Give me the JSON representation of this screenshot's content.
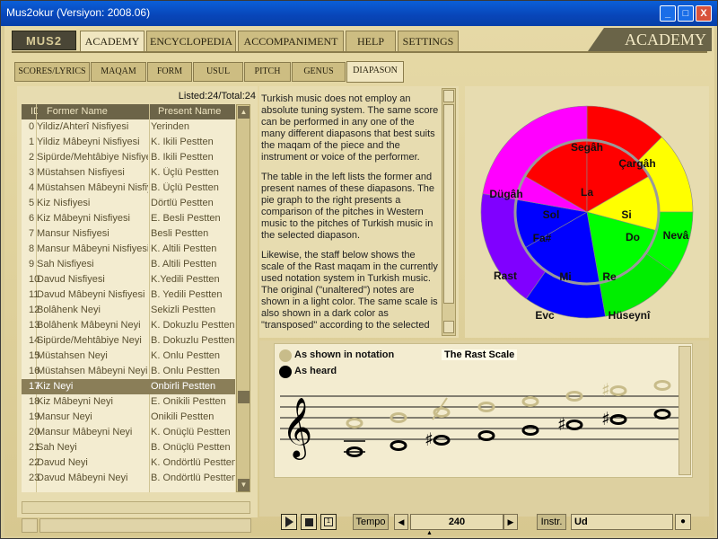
{
  "window": {
    "title": "Mus2okur  (Versiyon: 2008.06)",
    "controls": [
      "_",
      "□",
      "X"
    ]
  },
  "logo": "MUS2",
  "header": {
    "title": "ACADEMY"
  },
  "main_tabs": [
    {
      "label": "ACADEMY",
      "active": true
    },
    {
      "label": "ENCYCLOPEDIA",
      "active": false
    },
    {
      "label": "ACCOMPANIMENT",
      "active": false
    },
    {
      "label": "HELP",
      "active": false
    },
    {
      "label": "SETTINGS",
      "active": false
    }
  ],
  "sub_tabs": [
    {
      "label": "SCORES/LYRICS"
    },
    {
      "label": "MAQAM"
    },
    {
      "label": "FORM"
    },
    {
      "label": "USUL"
    },
    {
      "label": "PITCH"
    },
    {
      "label": "GENUS"
    },
    {
      "label": "DIAPASON",
      "active": true
    }
  ],
  "list": {
    "listed": "Listed:24/Total:24",
    "columns": [
      "ID",
      "Former Name",
      "Present Name"
    ],
    "selected_index": 17,
    "rows": [
      [
        "0",
        "Yildiz/Ahterî Nisfiyesi",
        "Yerinden"
      ],
      [
        "1",
        "Yildiz Mâbeyni Nisfiyesi",
        "K. Ikili Pestten"
      ],
      [
        "2",
        "Sipürde/Mehtâbiye Nisfiyesi",
        "B. Ikili Pestten"
      ],
      [
        "3",
        "Müstahsen Nisfiyesi",
        "K. Üçlü Pestten"
      ],
      [
        "4",
        "Müstahsen Mâbeyni Nisfiyesi",
        "B. Üçlü Pestten"
      ],
      [
        "5",
        "Kiz Nisfiyesi",
        "Dörtlü Pestten"
      ],
      [
        "6",
        "Kiz Mâbeyni Nisfiyesi",
        "E. Besli Pestten"
      ],
      [
        "7",
        "Mansur Nisfiyesi",
        "Besli Pestten"
      ],
      [
        "8",
        "Mansur Mâbeyni Nisfiyesi",
        "K. Altili Pestten"
      ],
      [
        "9",
        "Sah Nisfiyesi",
        "B. Altili Pestten"
      ],
      [
        "10",
        "Davud Nisfiyesi",
        "K.Yedili Pestten"
      ],
      [
        "11",
        "Davud Mâbeyni Nisfiyesi",
        "B. Yedili Pestten"
      ],
      [
        "12",
        "Bolâhenk Neyi",
        "Sekizli Pestten"
      ],
      [
        "13",
        "Bolâhenk Mâbeyni Neyi",
        "K. Dokuzlu Pestten"
      ],
      [
        "14",
        "Sipürde/Mehtâbiye Neyi",
        "B. Dokuzlu Pestten"
      ],
      [
        "15",
        "Müstahsen Neyi",
        "K. Onlu Pestten"
      ],
      [
        "16",
        "Müstahsen Mâbeyni Neyi",
        "B. Onlu Pestten"
      ],
      [
        "17",
        "Kiz Neyi",
        "Onbirli Pestten"
      ],
      [
        "18",
        "Kiz Mâbeyni Neyi",
        "E. Onikili Pestten"
      ],
      [
        "19",
        "Mansur Neyi",
        "Onikili Pestten"
      ],
      [
        "20",
        "Mansur Mâbeyni Neyi",
        "K. Onüçlü Pestten"
      ],
      [
        "21",
        "Sah Neyi",
        "B. Onüçlü Pestten"
      ],
      [
        "22",
        "Davud Neyi",
        "K. Ondörtlü Pestten"
      ],
      [
        "23",
        "Davud Mâbeyni Neyi",
        "B. Ondörtlü Pestten"
      ]
    ]
  },
  "description": {
    "p1": "Turkish music does not employ an absolute tuning system. The same score can be performed in any one of the many different diapasons that best suits the maqam of the piece and the instrument or voice of the performer.",
    "p2": "The table in the left lists the former and present names of these diapasons. The pie graph to the right presents a comparison of the pitches in Western music to the pitches of Turkish music in the selected diapason.",
    "p3": "Likewise, the staff below shows the scale of the Rast maqam in the currently used notation system in Turkish music. The original (\"unaltered\") notes are shown in a light color. The same scale is also shown in a dark color as \"transposed\" according to the selected"
  },
  "pie": {
    "outer": [
      {
        "label": "Segâh",
        "color": "#ff0000"
      },
      {
        "label": "Çargâh",
        "color": "#ffff00"
      },
      {
        "label": "Nevâ",
        "color": "#00ff00"
      },
      {
        "label": "Hüseynî",
        "color": "#00ee00"
      },
      {
        "label": "Evc",
        "color": "#0000ff"
      },
      {
        "label": "Rast",
        "color": "#8000ff"
      },
      {
        "label": "Dügâh",
        "color": "#ff00ff"
      }
    ],
    "inner": [
      {
        "label": "La",
        "color": "#ff0000"
      },
      {
        "label": "Si",
        "color": "#ff0000"
      },
      {
        "label": "Do",
        "color": "#ffff00"
      },
      {
        "label": "Re",
        "color": "#00ff00"
      },
      {
        "label": "Mi",
        "color": "#0000ff"
      },
      {
        "label": "Fa#",
        "color": "#0000ff"
      },
      {
        "label": "Sol",
        "color": "#ff00ff"
      }
    ]
  },
  "staff": {
    "legend_notation": "As shown in notation",
    "legend_heard": "As heard",
    "title": "The Rast Scale",
    "light_color": "#c8bc8a",
    "dark_color": "#000000"
  },
  "transport": {
    "tempo_label": "Tempo",
    "tempo_value": "240",
    "instr_label": "Instr.",
    "instr_value": "Ud"
  }
}
